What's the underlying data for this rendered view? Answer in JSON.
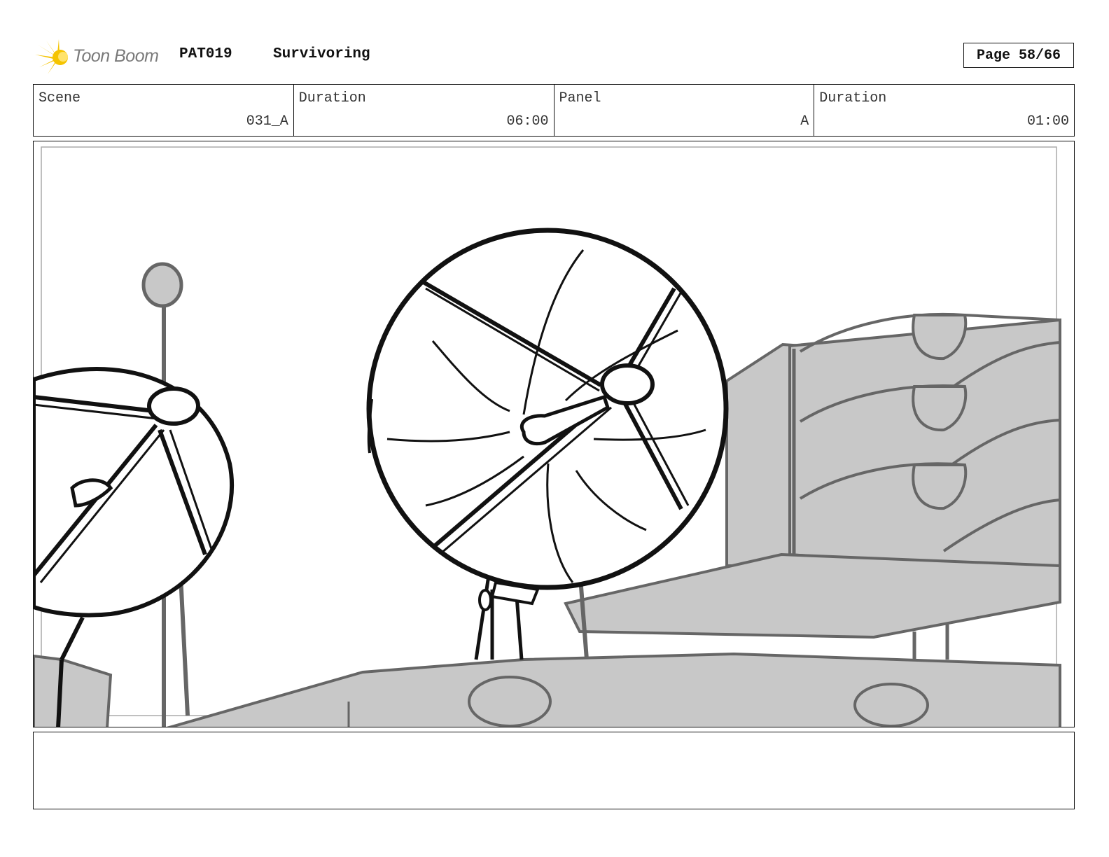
{
  "header": {
    "logo_text": "Toon Boom",
    "project_code": "PAT019",
    "project_title": "Survivoring",
    "page_label": "Page 58/66"
  },
  "info": {
    "scene_label": "Scene",
    "scene_value": "031_A",
    "scene_duration_label": "Duration",
    "scene_duration_value": "06:00",
    "panel_label": "Panel",
    "panel_value": "A",
    "panel_duration_label": "Duration",
    "panel_duration_value": "01:00"
  },
  "panel_image": {
    "subject": "Storyboard sketch of radar satellite dishes beside a grey roof structure"
  },
  "notes": {
    "text": ""
  },
  "colors": {
    "logo_sun": "#f5c400",
    "logo_text": "#7a7a7a",
    "sketch_grey": "#c8c8c8",
    "sketch_line": "#111111",
    "sketch_grey_line": "#666666"
  }
}
